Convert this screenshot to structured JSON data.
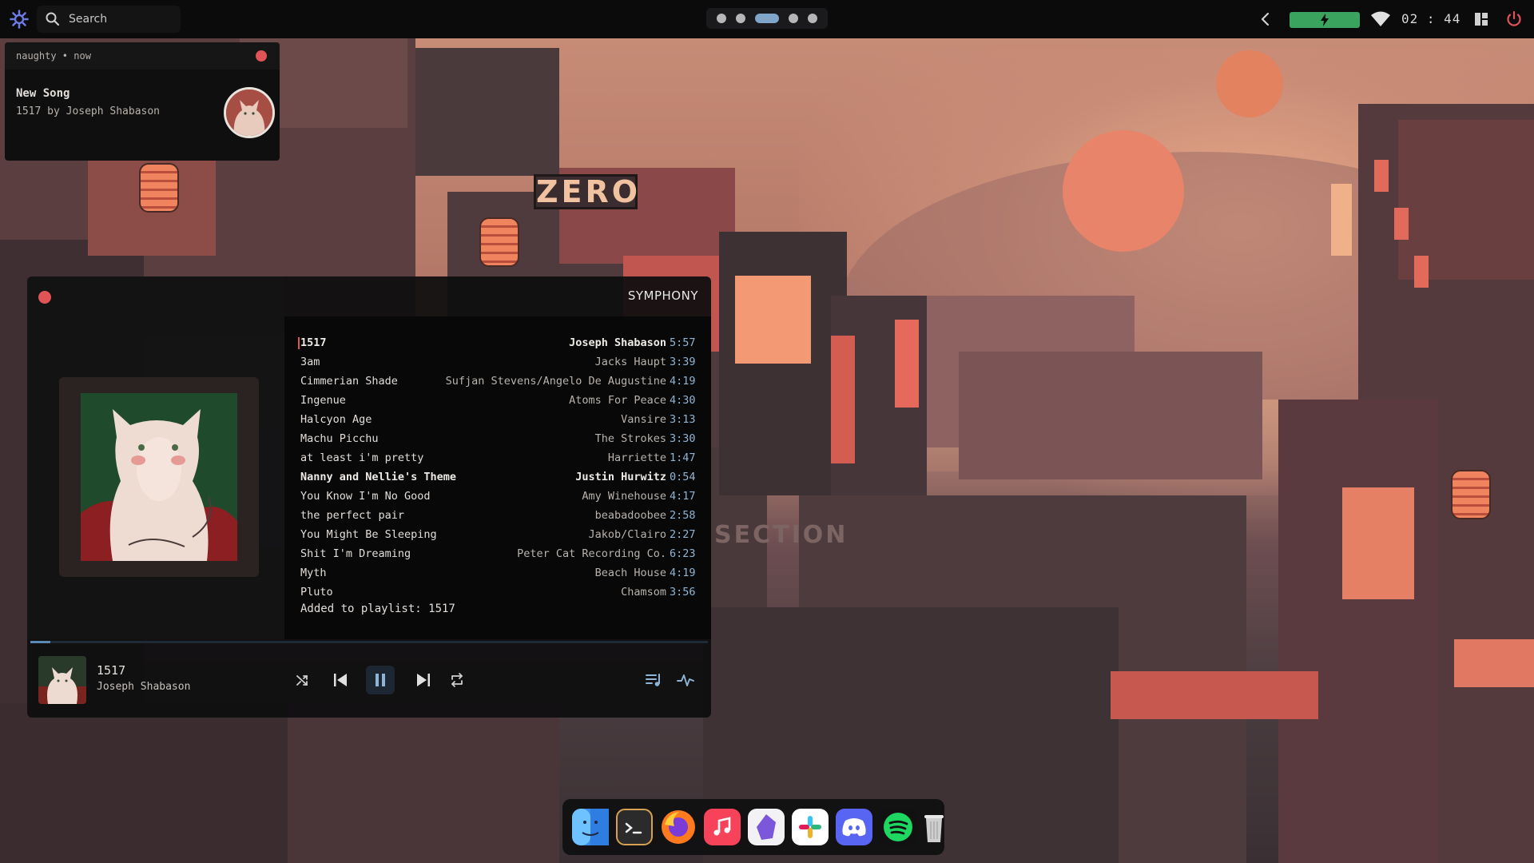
{
  "topbar": {
    "search": {
      "placeholder": "Search",
      "value": ""
    },
    "workspaces": [
      {
        "active": false
      },
      {
        "active": false
      },
      {
        "active": true
      },
      {
        "active": false
      },
      {
        "active": false
      }
    ],
    "clock": "02 : 44",
    "battery_color": "#3aa35e",
    "icons": [
      "app-launcher-icon",
      "search-icon",
      "chevron-left-icon",
      "battery-bolt-icon",
      "wifi-icon",
      "layout-icon",
      "power-icon"
    ]
  },
  "notification": {
    "app": "naughty • now",
    "title": "New Song",
    "body": "1517 by Joseph Shabason"
  },
  "wallpaper": {
    "signs": {
      "zero": "ZERO",
      "section": "SECTION"
    }
  },
  "player": {
    "app_title": "SYMPHONY",
    "tracks": [
      {
        "title": "1517",
        "artist": "Joseph Shabason",
        "duration": "5:57",
        "current": true,
        "bold": true
      },
      {
        "title": "3am",
        "artist": "Jacks Haupt",
        "duration": "3:39"
      },
      {
        "title": "Cimmerian Shade",
        "artist": "Sufjan Stevens/Angelo De Augustine",
        "duration": "4:19"
      },
      {
        "title": "Ingenue",
        "artist": "Atoms For Peace",
        "duration": "4:30"
      },
      {
        "title": "Halcyon Age",
        "artist": "Vansire",
        "duration": "3:13"
      },
      {
        "title": "Machu Picchu",
        "artist": "The Strokes",
        "duration": "3:30"
      },
      {
        "title": "at least i'm pretty",
        "artist": "Harriette",
        "duration": "1:47"
      },
      {
        "title": "Nanny and Nellie's Theme",
        "artist": "Justin Hurwitz",
        "duration": "0:54",
        "bold": true
      },
      {
        "title": "You Know I'm No Good",
        "artist": "Amy Winehouse",
        "duration": "4:17"
      },
      {
        "title": "the perfect pair",
        "artist": "beabadoobee",
        "duration": "2:58"
      },
      {
        "title": "You Might Be Sleeping",
        "artist": "Jakob/Clairo",
        "duration": "2:27"
      },
      {
        "title": "Shit I'm Dreaming",
        "artist": "Peter Cat Recording Co.",
        "duration": "6:23"
      },
      {
        "title": "Myth",
        "artist": "Beach House",
        "duration": "4:19"
      },
      {
        "title": "Pluto",
        "artist": "Chamsom",
        "duration": "3:56"
      }
    ],
    "added_message": "Added to playlist: 1517",
    "progress": 0.03,
    "accent_color": "#8fb4d4",
    "now_playing": {
      "title": "1517",
      "artist": "Joseph Shabason"
    },
    "controls": [
      "shuffle-icon",
      "previous-icon",
      "pause-icon",
      "next-icon",
      "repeat-icon",
      "queue-icon",
      "visualizer-icon"
    ]
  },
  "dock": {
    "apps": [
      {
        "name": "finder-icon",
        "color": "#3b8fe8"
      },
      {
        "name": "terminal-icon",
        "color": "#2b2b2b"
      },
      {
        "name": "firefox-icon",
        "color": "#ff7a1f"
      },
      {
        "name": "music-icon",
        "color": "#f7435a"
      },
      {
        "name": "obsidian-icon",
        "color": "#7b57d9"
      },
      {
        "name": "slack-icon",
        "color": "#ffffff"
      },
      {
        "name": "discord-icon",
        "color": "#5865f2"
      },
      {
        "name": "spotify-icon",
        "color": "#1ed760"
      },
      {
        "name": "trash-icon",
        "color": "#d8d8d8"
      }
    ]
  }
}
